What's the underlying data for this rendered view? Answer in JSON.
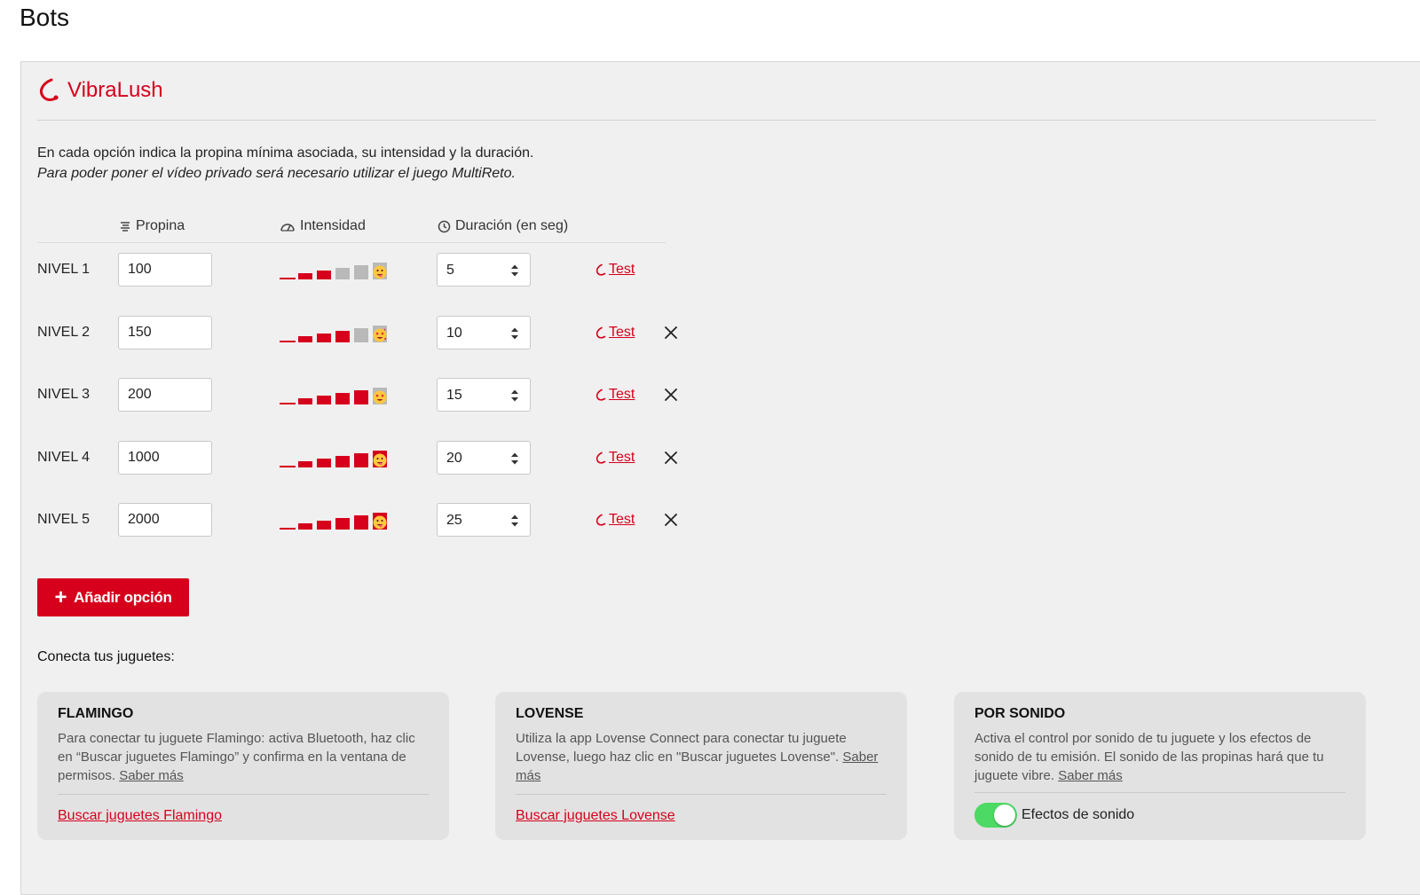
{
  "page": {
    "title": "Bots"
  },
  "brand": {
    "name": "VibraLush",
    "accent": "#d6001c"
  },
  "intro": {
    "line1": "En cada opción indica la propina mínima asociada, su intensidad y la duración.",
    "line2": "Para poder poner el vídeo privado será necesario utilizar el juego MultiReto."
  },
  "table": {
    "headers": {
      "propina": "Propina",
      "intensidad": "Intensidad",
      "duracion": "Duración (en seg)"
    },
    "test_label": "Test",
    "intensity_max": 5,
    "rows": [
      {
        "label": "NIVEL 1",
        "tip": "100",
        "intensity": 2,
        "duration": "5",
        "emoji": "tongue-wink-face-icon",
        "removable": false
      },
      {
        "label": "NIVEL 2",
        "tip": "150",
        "intensity": 3,
        "duration": "10",
        "emoji": "hearts-face-icon",
        "removable": true
      },
      {
        "label": "NIVEL 3",
        "tip": "200",
        "intensity": 4,
        "duration": "15",
        "emoji": "heart-eyes-face-icon",
        "removable": true
      },
      {
        "label": "NIVEL 4",
        "tip": "1000",
        "intensity": 5,
        "duration": "20",
        "emoji": "zany-face-icon",
        "removable": true
      },
      {
        "label": "NIVEL 5",
        "tip": "2000",
        "intensity": 5,
        "duration": "25",
        "emoji": "zany-face-icon",
        "removable": true
      }
    ]
  },
  "actions": {
    "add_option": "Añadir opción"
  },
  "connect": {
    "title": "Conecta tus juguetes:",
    "more_label": "Saber más",
    "cards": {
      "flamingo": {
        "title": "FLAMINGO",
        "text": "Para conectar tu juguete Flamingo: activa Bluetooth, haz clic en “Buscar juguetes Flamingo” y confirma en la ventana de permisos.",
        "link": "Buscar juguetes Flamingo"
      },
      "lovense": {
        "title": "LOVENSE",
        "text": "Utiliza la app Lovense Connect para conectar tu juguete Lovense, luego haz clic en \"Buscar juguetes Lovense\".",
        "link": "Buscar juguetes Lovense"
      },
      "sonido": {
        "title": "POR SONIDO",
        "text": "Activa el control por sonido de tu juguete y los efectos de sonido de tu emisión. El sonido de las propinas hará que tu juguete vibre.",
        "toggle_label": "Efectos de sonido",
        "toggle_on": true
      }
    }
  }
}
